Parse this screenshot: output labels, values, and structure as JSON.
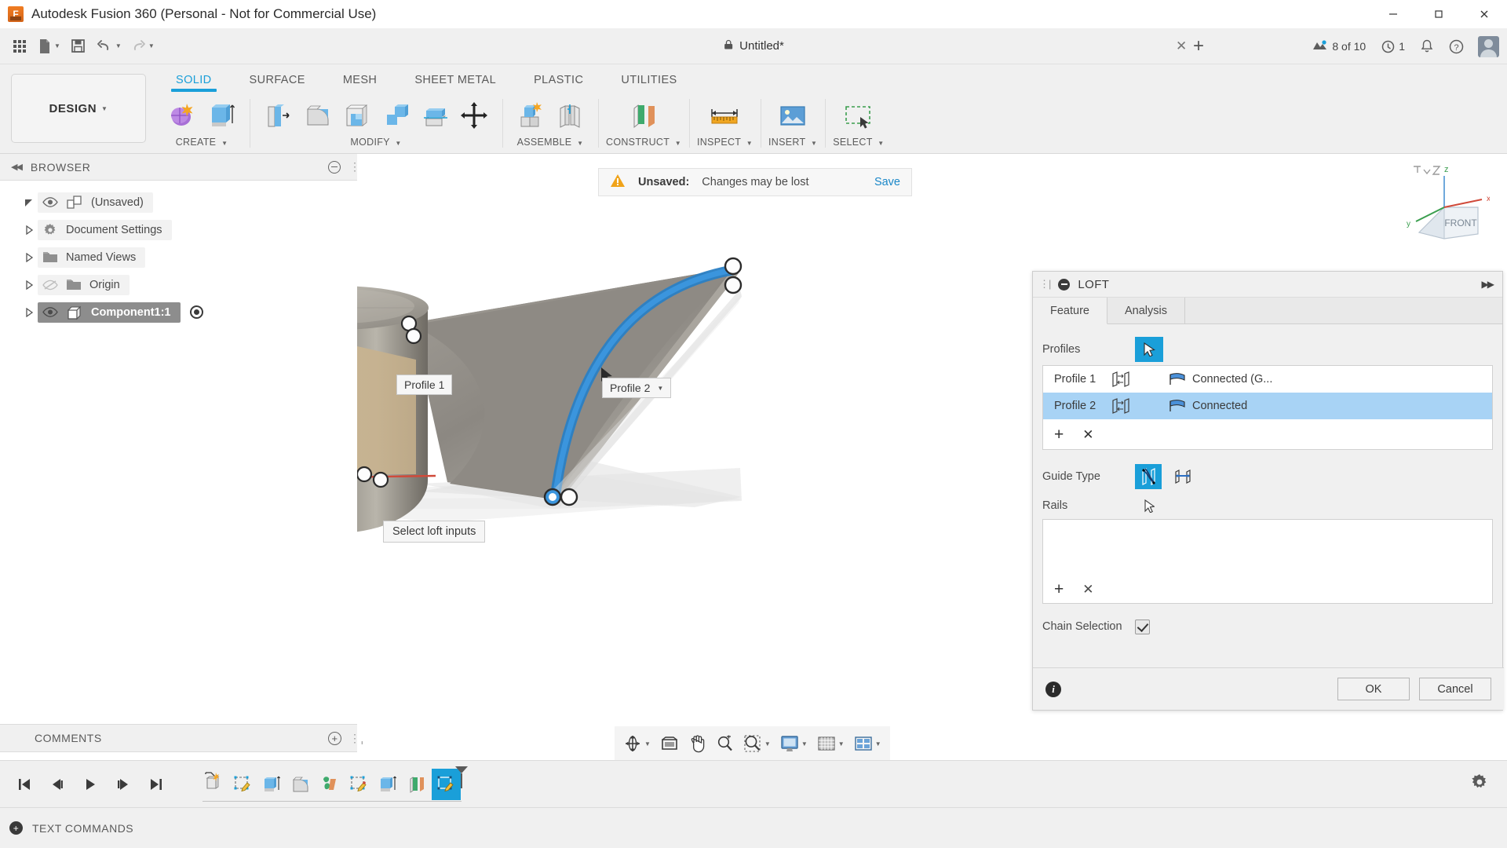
{
  "window": {
    "title": "Autodesk Fusion 360 (Personal - Not for Commercial Use)",
    "minimize": "–",
    "maximize": "❐",
    "close": "✕"
  },
  "quick_access": {
    "grid_icon": "app-grid-icon",
    "new_icon": "new-document-icon",
    "save_icon": "save-icon",
    "undo_icon": "undo-icon",
    "redo_icon": "redo-icon",
    "document_title": "Untitled*",
    "document_close": "✕",
    "add_tab": "+",
    "jobs_label": "8 of 10",
    "history_label": "1",
    "notifications_icon": "bell-icon",
    "help_icon": "help-icon",
    "avatar": "user-avatar"
  },
  "ribbon": {
    "workspace": "DESIGN",
    "tabs": [
      {
        "label": "SOLID",
        "active": true
      },
      {
        "label": "SURFACE",
        "active": false
      },
      {
        "label": "MESH",
        "active": false
      },
      {
        "label": "SHEET METAL",
        "active": false
      },
      {
        "label": "PLASTIC",
        "active": false
      },
      {
        "label": "UTILITIES",
        "active": false
      }
    ],
    "groups": [
      {
        "label": "CREATE",
        "dropdown": true,
        "icons": [
          "sketch-create-icon",
          "extrude-icon"
        ]
      },
      {
        "label": "MODIFY",
        "dropdown": true,
        "icons": [
          "press-pull-icon",
          "fillet-icon",
          "shell-icon",
          "combine-icon",
          "offset-face-icon",
          "move-copy-icon"
        ]
      },
      {
        "label": "ASSEMBLE",
        "dropdown": true,
        "icons": [
          "new-component-icon",
          "joint-icon"
        ]
      },
      {
        "label": "CONSTRUCT",
        "dropdown": true,
        "icons": [
          "offset-plane-icon"
        ]
      },
      {
        "label": "INSPECT",
        "dropdown": true,
        "icons": [
          "measure-icon"
        ]
      },
      {
        "label": "INSERT",
        "dropdown": true,
        "icons": [
          "insert-canvas-icon"
        ]
      },
      {
        "label": "SELECT",
        "dropdown": true,
        "icons": [
          "select-window-icon"
        ]
      }
    ]
  },
  "browser": {
    "header": "BROWSER",
    "collapse_icon": "collapse-left-icon",
    "minimize_icon": "minimize-panel-icon",
    "tree": [
      {
        "label": "(Unsaved)",
        "icon": "document-icon",
        "eye": true,
        "depth": 0,
        "selected": false,
        "expanded": true
      },
      {
        "label": "Document Settings",
        "icon": "gear-icon",
        "eye": false,
        "depth": 1,
        "selected": false,
        "expanded": false
      },
      {
        "label": "Named Views",
        "icon": "folder-icon",
        "eye": false,
        "depth": 1,
        "selected": false,
        "expanded": false
      },
      {
        "label": "Origin",
        "icon": "folder-icon",
        "eye": true,
        "eye_off": true,
        "depth": 1,
        "selected": false,
        "expanded": false
      },
      {
        "label": "Component1:1",
        "icon": "component-icon",
        "eye": true,
        "depth": 1,
        "selected": true,
        "expanded": false
      }
    ],
    "comments": "COMMENTS"
  },
  "banner": {
    "warning_icon": "warning-icon",
    "status": "Unsaved:",
    "message": "Changes may be lost",
    "save_link": "Save"
  },
  "viewcube": {
    "face": "FRONT",
    "axis_z": "z",
    "axis_x": "x",
    "axis_y": "y",
    "home_icon": "home-icon"
  },
  "canvas": {
    "profile1_label": "Profile 1",
    "profile2_label": "Profile 2",
    "hint": "Select loft inputs"
  },
  "loft_dialog": {
    "title": "LOFT",
    "collapse_icon": "collapse-icon",
    "expand_icon": "expand-right-icon",
    "tabs": [
      {
        "label": "Feature",
        "active": true
      },
      {
        "label": "Analysis",
        "active": false
      }
    ],
    "profiles_label": "Profiles",
    "profiles_select_icon": "cursor-select-icon",
    "profiles": [
      {
        "name": "Profile 1",
        "plane_icon": "profile-plane-icon",
        "condition_icon": "connected-icon",
        "condition": "Connected (G...",
        "selected": false
      },
      {
        "name": "Profile 2",
        "plane_icon": "profile-plane-icon",
        "condition_icon": "connected-icon",
        "condition": "Connected",
        "selected": true
      }
    ],
    "profiles_add": "+",
    "profiles_remove": "✕",
    "guide_type_label": "Guide Type",
    "guide_type_options": [
      {
        "name": "rails-guide-icon",
        "active": true
      },
      {
        "name": "centerline-guide-icon",
        "active": false
      }
    ],
    "rails_label": "Rails",
    "rails_items": [],
    "rails_add": "+",
    "rails_remove": "✕",
    "chain_selection_label": "Chain Selection",
    "chain_selection_checked": true,
    "info_icon": "info-icon",
    "ok_label": "OK",
    "cancel_label": "Cancel"
  },
  "nav_toolbar": [
    {
      "name": "orbit-icon",
      "dropdown": true
    },
    {
      "name": "look-at-icon",
      "dropdown": false
    },
    {
      "name": "pan-icon",
      "dropdown": false
    },
    {
      "name": "zoom-icon",
      "dropdown": false
    },
    {
      "name": "zoom-window-icon",
      "dropdown": true
    },
    {
      "name": "display-settings-icon",
      "dropdown": true
    },
    {
      "name": "grid-snaps-icon",
      "dropdown": true
    },
    {
      "name": "viewports-icon",
      "dropdown": true
    }
  ],
  "timeline": {
    "playback": [
      "go-to-start-icon",
      "step-back-icon",
      "play-icon",
      "step-forward-icon",
      "go-to-end-icon"
    ],
    "features": [
      {
        "name": "sketch-feature-icon",
        "active": false
      },
      {
        "name": "sketch-edit-icon",
        "active": false
      },
      {
        "name": "extrude-feature-icon",
        "active": false
      },
      {
        "name": "fillet-feature-icon",
        "active": false
      },
      {
        "name": "plane-feature-icon",
        "active": false
      },
      {
        "name": "sketch-edit-2-icon",
        "active": false
      },
      {
        "name": "extrude-2-icon",
        "active": false
      },
      {
        "name": "surface-feature-icon",
        "active": false
      },
      {
        "name": "loft-feature-icon",
        "active": true
      }
    ],
    "settings_icon": "gear-icon"
  },
  "text_commands": {
    "label": "TEXT COMMANDS",
    "icon": "text-commands-icon"
  },
  "colors": {
    "accent": "#1a9fd9",
    "selection": "#a8d3f5",
    "warning": "#f0a31a",
    "link": "#1a87c8",
    "panel": "#f0f0f0"
  }
}
